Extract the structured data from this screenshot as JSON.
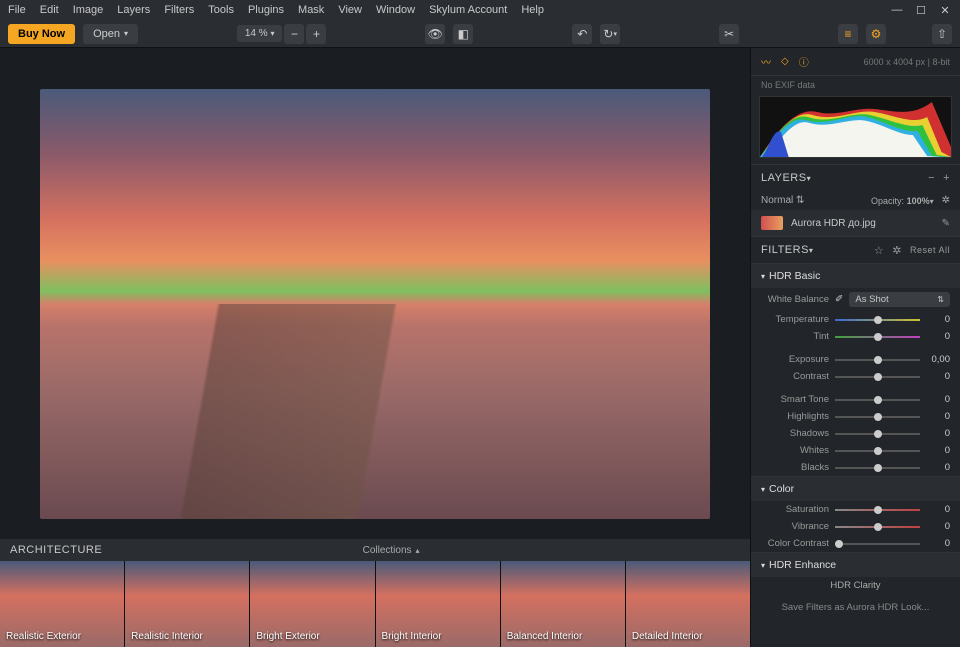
{
  "menu": [
    "File",
    "Edit",
    "Image",
    "Layers",
    "Filters",
    "Tools",
    "Plugins",
    "Mask",
    "View",
    "Window",
    "Skylum Account",
    "Help"
  ],
  "buy": "Buy Now",
  "open": "Open",
  "zoom": "14 %",
  "info": {
    "dims": "6000 x 4004 px",
    "depth": "8-bit",
    "exif": "No EXIF data"
  },
  "layers": {
    "title": "LAYERS",
    "blend": "Normal",
    "opacityLabel": "Opacity:",
    "opacity": "100%",
    "active": "Aurora HDR до.jpg"
  },
  "filters": {
    "title": "FILTERS",
    "reset": "Reset All"
  },
  "hdrbasic": {
    "title": "HDR Basic",
    "wbLabel": "White Balance",
    "wbValue": "As Shot",
    "sliders": [
      {
        "label": "Temperature",
        "value": "0",
        "pos": 50,
        "track": "temp"
      },
      {
        "label": "Tint",
        "value": "0",
        "pos": 50,
        "track": "tint"
      },
      {
        "label": "Exposure",
        "value": "0,00",
        "pos": 50
      },
      {
        "label": "Contrast",
        "value": "0",
        "pos": 50
      },
      {
        "label": "Smart Tone",
        "value": "0",
        "pos": 50
      },
      {
        "label": "Highlights",
        "value": "0",
        "pos": 50
      },
      {
        "label": "Shadows",
        "value": "0",
        "pos": 50
      },
      {
        "label": "Whites",
        "value": "0",
        "pos": 50
      },
      {
        "label": "Blacks",
        "value": "0",
        "pos": 50
      }
    ]
  },
  "color": {
    "title": "Color",
    "sliders": [
      {
        "label": "Saturation",
        "value": "0",
        "pos": 50,
        "track": "sat"
      },
      {
        "label": "Vibrance",
        "value": "0",
        "pos": 50,
        "track": "sat"
      },
      {
        "label": "Color Contrast",
        "value": "0",
        "pos": 5
      }
    ]
  },
  "enhance": {
    "title": "HDR Enhance",
    "clarity": "HDR Clarity"
  },
  "save": "Save Filters as Aurora HDR Look...",
  "presets": {
    "group": "ARCHITECTURE",
    "collections": "Collections",
    "items": [
      "Realistic Exterior",
      "Realistic Interior",
      "Bright Exterior",
      "Bright Interior",
      "Balanced Interior",
      "Detailed Interior"
    ]
  }
}
